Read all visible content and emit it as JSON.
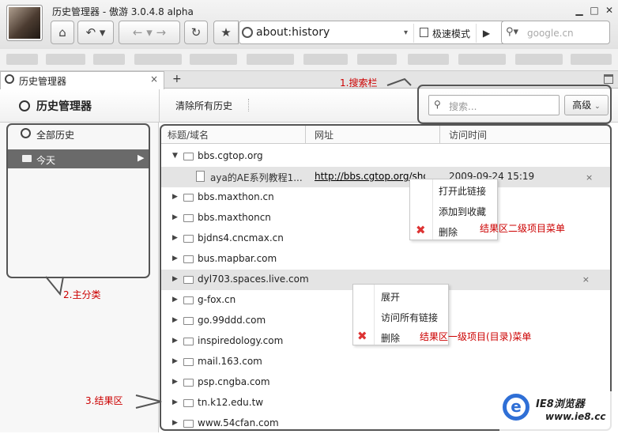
{
  "window": {
    "title": "历史管理器 - 傲游 3.0.4.8 alpha",
    "min": "▁",
    "max": "□",
    "close": "✕"
  },
  "toolbar": {
    "url": "about:history",
    "speed_mode": "极速模式",
    "search_placeholder": "google.cn"
  },
  "tab": {
    "label": "历史管理器",
    "close": "×",
    "new": "+"
  },
  "header": {
    "title": "历史管理器",
    "clear_all": "清除所有历史",
    "search_placeholder": "搜索...",
    "advanced": "高级"
  },
  "sidebar": {
    "all_history": "全部历史",
    "today": "今天"
  },
  "columns": {
    "title": "标题/域名",
    "url": "网址",
    "time": "访问时间"
  },
  "rows": [
    {
      "label": "bbs.cgtop.org",
      "expanded": true
    },
    {
      "label": "bbs.maxthon.cn"
    },
    {
      "label": "bbs.maxthoncn"
    },
    {
      "label": "bjdns4.cncmax.cn"
    },
    {
      "label": "bus.mapbar.com"
    },
    {
      "label": "dyl703.spaces.live.com"
    },
    {
      "label": "g-fox.cn"
    },
    {
      "label": "go.99ddd.com"
    },
    {
      "label": "inspiredology.com"
    },
    {
      "label": "mail.163.com"
    },
    {
      "label": "psp.cngba.com"
    },
    {
      "label": "tn.k12.edu.tw"
    },
    {
      "label": "www.54cfan.com"
    }
  ],
  "subitem": {
    "title": "aya的AE系列教程1...",
    "url": "http://bbs.cgtop.org/sho",
    "time": "2009-09-24 15:19",
    "close": "×"
  },
  "menu_level2": {
    "open": "打开此链接",
    "fav": "添加到收藏",
    "del": "删除"
  },
  "menu_level1": {
    "expand": "展开",
    "visit_all": "访问所有链接",
    "del": "删除"
  },
  "annotations": {
    "search": "1.搜索栏",
    "category": "2.主分类",
    "results": "3.结果区",
    "menu2": "结果区二级项目菜单",
    "menu1": "结果区一级项目(目录)菜单"
  },
  "watermark": {
    "line1": "IE8浏览器",
    "line2": "www.ie8.cc"
  }
}
